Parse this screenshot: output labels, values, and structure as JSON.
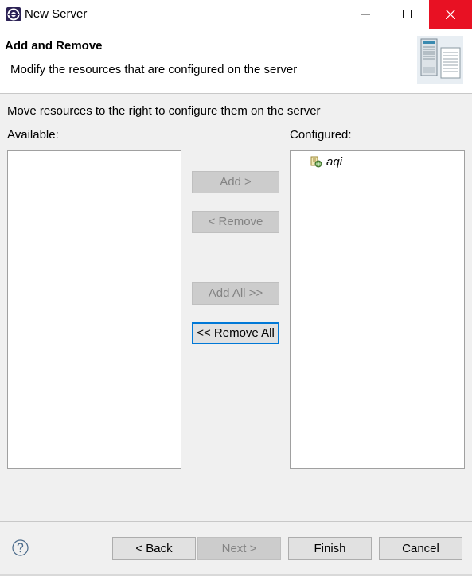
{
  "window": {
    "title": "New Server",
    "icon": "eclipse-app-icon"
  },
  "header": {
    "title": "Add and Remove",
    "description": "Modify the resources that are configured on the server",
    "graphic": "server-wizard-graphic"
  },
  "content": {
    "instruction": "Move resources to the right to configure them on the server",
    "available_label": "Available:",
    "configured_label": "Configured:",
    "available_items": [],
    "configured_items": [
      {
        "label": "aqi",
        "icon": "web-module-icon"
      }
    ]
  },
  "actions": {
    "add": {
      "label": "Add >",
      "enabled": false
    },
    "remove": {
      "label": "< Remove",
      "enabled": false
    },
    "add_all": {
      "label": "Add All >>",
      "enabled": false
    },
    "remove_all": {
      "label": "<< Remove All",
      "enabled": true,
      "focused": true
    }
  },
  "footer": {
    "help_icon": "help-icon",
    "back": {
      "label": "< Back",
      "enabled": true
    },
    "next": {
      "label": "Next >",
      "enabled": false
    },
    "finish": {
      "label": "Finish",
      "enabled": true
    },
    "cancel": {
      "label": "Cancel",
      "enabled": true
    }
  },
  "colors": {
    "close_button": "#e81123",
    "focus_border": "#0078d7",
    "dialog_background": "#f0f0f0"
  }
}
